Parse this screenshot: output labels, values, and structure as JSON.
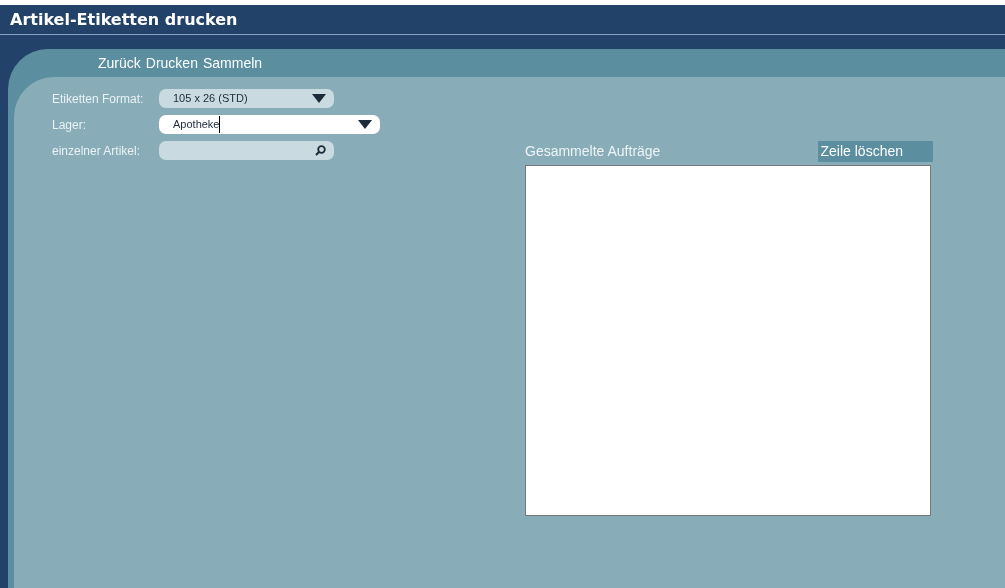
{
  "window": {
    "title": "Artikel-Etiketten drucken"
  },
  "menu": [
    {
      "label": "Zurück"
    },
    {
      "label": "Drucken"
    },
    {
      "label": "Sammeln"
    }
  ],
  "form": [
    {
      "kind": "select",
      "label": "Etiketten Format:",
      "value": "105 x 26 (STD)",
      "focused": false
    },
    {
      "kind": "select",
      "label": "Lager:",
      "value": "Apotheke",
      "focused": true
    },
    {
      "kind": "search",
      "label": "einzelner Artikel:",
      "focused": false
    }
  ],
  "orders": {
    "title": "Gesammelte Aufträge",
    "delete_button": "Zeile löschen"
  }
}
